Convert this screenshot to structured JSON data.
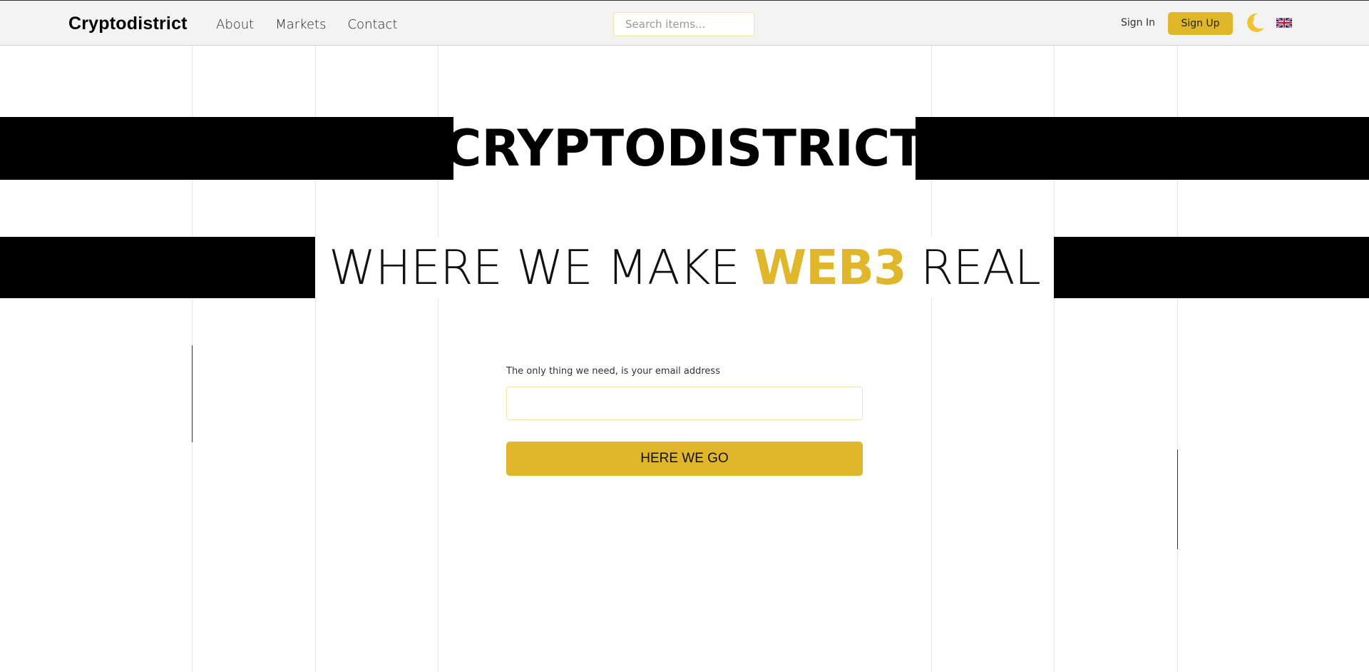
{
  "navbar": {
    "brand": "Cryptodistrict",
    "links": [
      "About",
      "Markets",
      "Contact"
    ],
    "search_placeholder": "Search items...",
    "sign_in": "Sign In",
    "sign_up": "Sign Up",
    "theme_icon": "moon-icon",
    "language_icon": "uk-flag-icon"
  },
  "hero": {
    "title": "CRYPTODISTRICT",
    "subtitle_before": "WHERE WE MAKE ",
    "subtitle_accent": "WEB3",
    "subtitle_after": " REAL"
  },
  "signup_form": {
    "label": "The only thing we need, is your email address",
    "email_value": "",
    "submit_label": "HERE WE GO"
  },
  "colors": {
    "accent": "#e0b72a",
    "band": "#000000",
    "navbar_bg": "#f3f3f3"
  }
}
